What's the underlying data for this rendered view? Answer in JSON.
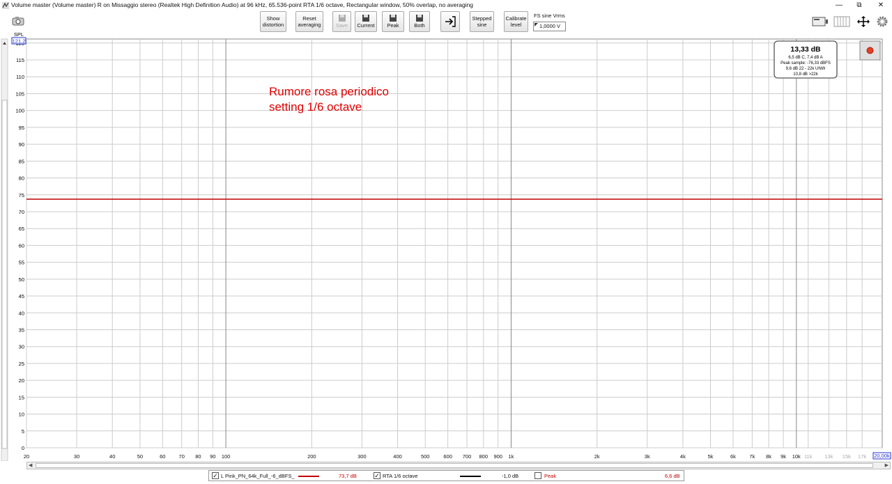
{
  "window": {
    "title": "Volume master (Volume master) R on Missaggio stereo (Realtek High Definition Audio) at 96 kHz, 65.536-point RTA 1/6 octave, Rectangular window, 50% overlap, no averaging",
    "min_label": "—",
    "restore_label": "⧉",
    "close_label": "✕"
  },
  "toolbar": {
    "show_distortion": [
      "Show",
      "distortion"
    ],
    "reset_averaging": [
      "Reset",
      "averaging"
    ],
    "save_disabled": "Save",
    "current": "Current",
    "peak": "Peak",
    "both": "Both",
    "stepped_sine": [
      "Stepped",
      "sine"
    ],
    "calibrate_level": [
      "Calibrate",
      "level"
    ],
    "fs_label": "FS sine Vrms",
    "fs_value": "1,0000 V"
  },
  "readout": {
    "main": "13,33 dB",
    "line1": "6,5 dB C, 7,4 dB A",
    "line2": "Peak sample: -76,33 dBFS",
    "line3": "9,6 dB 22 - 22k UNW",
    "line4": "10,8 dB >22k"
  },
  "annotation": [
    "Rumore rosa periodico",
    "setting 1/6 octave"
  ],
  "legend": {
    "items": [
      {
        "label": "L Pink_PN_64k_Full_-6_dBFS_",
        "value": "73,7 dB",
        "checked": true,
        "color": "#c00000"
      },
      {
        "label": "RTA 1/6 octave",
        "value": "-1,0 dB",
        "checked": true,
        "color": "#000000"
      },
      {
        "label": "Peak",
        "value": "6,6 dB",
        "checked": false,
        "color": "#c00000"
      }
    ]
  },
  "chart_data": {
    "type": "line",
    "ylabel": "SPL",
    "y_top_value": "121,2",
    "x_end_value": "20,00k",
    "xscale": "log",
    "xlim": [
      20,
      20000
    ],
    "ylim": [
      0,
      121.2
    ],
    "grid": true,
    "yticks": [
      0,
      5,
      10,
      15,
      20,
      25,
      30,
      35,
      40,
      45,
      50,
      55,
      60,
      65,
      70,
      75,
      80,
      85,
      90,
      95,
      100,
      105,
      110,
      115,
      120
    ],
    "xticks": [
      {
        "v": 20,
        "label": "20",
        "muted": false
      },
      {
        "v": 30,
        "label": "30",
        "muted": false
      },
      {
        "v": 40,
        "label": "40",
        "muted": false
      },
      {
        "v": 50,
        "label": "50",
        "muted": false
      },
      {
        "v": 60,
        "label": "60",
        "muted": false
      },
      {
        "v": 70,
        "label": "70",
        "muted": false
      },
      {
        "v": 80,
        "label": "80",
        "muted": false
      },
      {
        "v": 90,
        "label": "90",
        "muted": false
      },
      {
        "v": 100,
        "label": "100",
        "muted": false
      },
      {
        "v": 200,
        "label": "200",
        "muted": false
      },
      {
        "v": 300,
        "label": "300",
        "muted": false
      },
      {
        "v": 400,
        "label": "400",
        "muted": false
      },
      {
        "v": 500,
        "label": "500",
        "muted": false
      },
      {
        "v": 600,
        "label": "600",
        "muted": false
      },
      {
        "v": 700,
        "label": "700",
        "muted": false
      },
      {
        "v": 800,
        "label": "800",
        "muted": false
      },
      {
        "v": 900,
        "label": "900",
        "muted": false
      },
      {
        "v": 1000,
        "label": "1k",
        "muted": false
      },
      {
        "v": 2000,
        "label": "2k",
        "muted": false
      },
      {
        "v": 3000,
        "label": "3k",
        "muted": false
      },
      {
        "v": 4000,
        "label": "4k",
        "muted": false
      },
      {
        "v": 5000,
        "label": "5k",
        "muted": false
      },
      {
        "v": 6000,
        "label": "6k",
        "muted": false
      },
      {
        "v": 7000,
        "label": "7k",
        "muted": false
      },
      {
        "v": 8000,
        "label": "8k",
        "muted": false
      },
      {
        "v": 9000,
        "label": "9k",
        "muted": false
      },
      {
        "v": 10000,
        "label": "10k",
        "muted": false
      },
      {
        "v": 11000,
        "label": "11k",
        "muted": true
      },
      {
        "v": 13000,
        "label": "13k",
        "muted": true
      },
      {
        "v": 15000,
        "label": "15k",
        "muted": true
      },
      {
        "v": 17000,
        "label": "17k",
        "muted": true
      }
    ],
    "series": [
      {
        "name": "L Pink_PN_64k_Full_-6_dBFS_",
        "color": "#c00000",
        "x": [
          20,
          20000
        ],
        "y": [
          73.7,
          73.7
        ]
      }
    ]
  }
}
